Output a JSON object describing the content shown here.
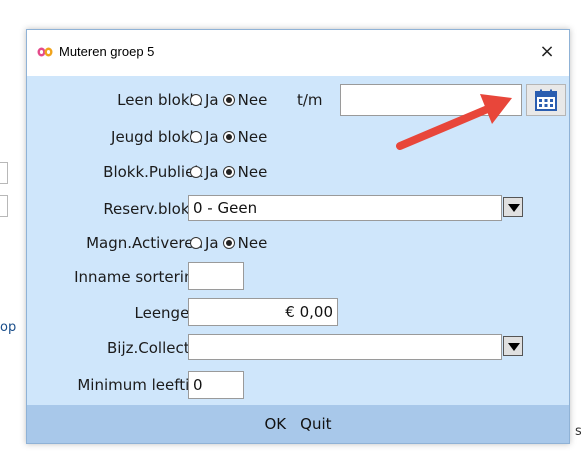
{
  "background": {
    "fragment_left": "op",
    "fragment_right": "s"
  },
  "dialog": {
    "title": "Muteren groep 5",
    "close_glyph": "×",
    "app_icon": "butterfly-logo-icon"
  },
  "fields": {
    "leen_blokk": {
      "label": "Leen blokk.",
      "opt_yes": "Ja",
      "opt_no": "Nee",
      "selected": "Nee",
      "tm_label": "t/m",
      "date_value": ""
    },
    "jeugd_blokk": {
      "label": "Jeugd blokk.",
      "opt_yes": "Ja",
      "opt_no": "Nee",
      "selected": "Nee"
    },
    "blokk_publiek": {
      "label": "Blokk.Publiek",
      "opt_yes": "Ja",
      "opt_no": "Nee",
      "selected": "Nee"
    },
    "reserv_blokk": {
      "label": "Reserv.blokk.",
      "value": "0 - Geen"
    },
    "magn_activeren": {
      "label": "Magn.Activeren",
      "opt_yes": "Ja",
      "opt_no": "Nee",
      "selected": "Nee"
    },
    "inname_sortering": {
      "label": "Inname sortering",
      "value": ""
    },
    "leengeld": {
      "label": "Leengeld",
      "value": "€ 0,00"
    },
    "bijz_collectie": {
      "label": "Bijz.Collectie",
      "value": ""
    },
    "minimum_leeftijd": {
      "label": "Minimum leeftijd",
      "value": "0"
    }
  },
  "footer": {
    "ok_label": "OK",
    "quit_label": "Quit"
  },
  "annotation": {
    "arrow_color": "#e8463a",
    "icon": "red-arrow-annotation"
  },
  "icons": {
    "calendar": "calendar-icon",
    "dropdown": "dropdown-arrow-icon"
  },
  "colors": {
    "dialog_bg": "#cfe6fb",
    "footer_bg": "#a8c8ea",
    "calendar_blue": "#2a5db0"
  }
}
